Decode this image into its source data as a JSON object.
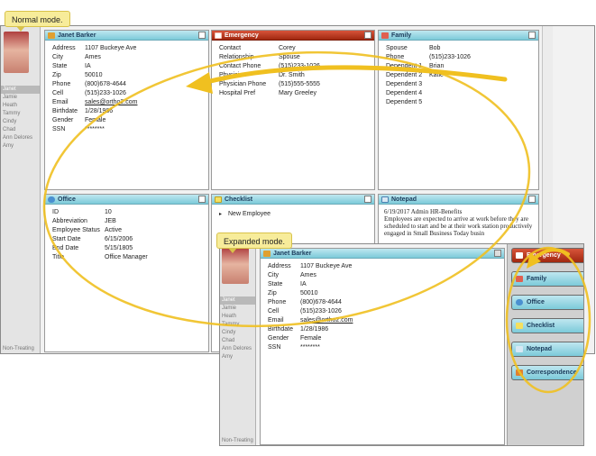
{
  "callouts": {
    "normal": "Normal mode.",
    "expanded": "Expanded mode."
  },
  "sidebar_items": [
    "Janet",
    "Jamie",
    "Heath",
    "Tammy",
    "Cindy",
    "Chad",
    "Ann Delores",
    "Amy"
  ],
  "sidebar_footer": "Non-Treating",
  "contact": {
    "title": "Janet Barker",
    "fields": [
      {
        "k": "Address",
        "v": "1107 Buckeye Ave"
      },
      {
        "k": "City",
        "v": "Ames"
      },
      {
        "k": "State",
        "v": "IA"
      },
      {
        "k": "Zip",
        "v": "50010"
      },
      {
        "k": "Phone",
        "v": "(800)678-4644"
      },
      {
        "k": "Cell",
        "v": "(515)233-1026"
      },
      {
        "k": "Email",
        "v": "sales@ortho2.com"
      },
      {
        "k": "Birthdate",
        "v": "1/28/1986"
      },
      {
        "k": "Gender",
        "v": "Female"
      },
      {
        "k": "SSN",
        "v": "********"
      }
    ]
  },
  "emergency": {
    "title": "Emergency",
    "fields": [
      {
        "k": "Contact",
        "v": "Corey"
      },
      {
        "k": "Relationship",
        "v": "Spouse"
      },
      {
        "k": "Contact Phone",
        "v": "(515)233-1026"
      },
      {
        "k": "Physician",
        "v": "Dr. Smith"
      },
      {
        "k": "Physician Phone",
        "v": "(515)555-5555"
      },
      {
        "k": "Hospital Pref",
        "v": "Mary Greeley"
      }
    ]
  },
  "family": {
    "title": "Family",
    "fields": [
      {
        "k": "Spouse",
        "v": "Bob"
      },
      {
        "k": "Phone",
        "v": "(515)233-1026"
      },
      {
        "k": "Dependent 1",
        "v": "Brian"
      },
      {
        "k": "Dependent 2",
        "v": "Katie"
      },
      {
        "k": "Dependent 3",
        "v": ""
      },
      {
        "k": "Dependent 4",
        "v": ""
      },
      {
        "k": "Dependent 5",
        "v": ""
      }
    ]
  },
  "office": {
    "title": "Office",
    "fields": [
      {
        "k": "ID",
        "v": "10"
      },
      {
        "k": "Abbreviation",
        "v": "JEB"
      },
      {
        "k": "Employee Status",
        "v": "Active"
      },
      {
        "k": "Start Date",
        "v": "6/15/2006"
      },
      {
        "k": "End Date",
        "v": "5/15/1805"
      },
      {
        "k": "Title",
        "v": "Office Manager"
      }
    ]
  },
  "checklist": {
    "title": "Checklist",
    "items": [
      "New Employee"
    ]
  },
  "notepad": {
    "title": "Notepad",
    "entry_header": "6/19/2017  Admin  HR-Benefits",
    "entry_text": "Employees are expected to arrive at work before they are scheduled to start and be at their work station productively engaged in Small Business Today busin"
  },
  "expanded_tabs": [
    "Emergency",
    "Family",
    "Office",
    "Checklist",
    "Notepad",
    "Correspondence"
  ],
  "colors": {
    "accent": "#7ccad9",
    "red_header": "#b53820",
    "highlight": "#f0c020",
    "callout": "#f7ec9a"
  }
}
